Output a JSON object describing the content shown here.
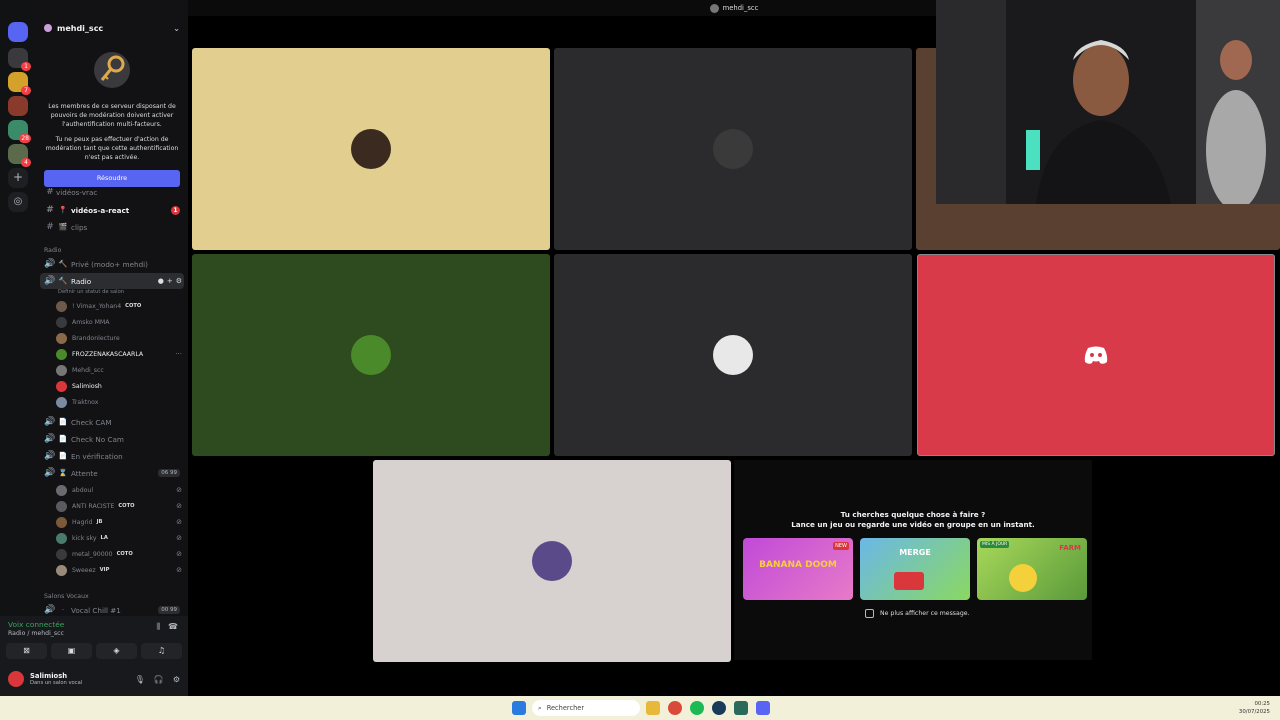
{
  "server": {
    "name": "mehdi_scc"
  },
  "mfa": {
    "text1": "Les membres de ce serveur disposant de pouvoirs de modération doivent activer l'authentification multi-facteurs.",
    "text2": "Tu ne peux pas effectuer d'action de modération tant que cette authentification n'est pas activée.",
    "resolve": "Résoudre"
  },
  "channels": {
    "partial": "vidéos-vrac",
    "videos": "vidéos-a-react",
    "videos_unread": "1",
    "clips": "clips",
    "cat_radio": "Radio",
    "prive": "Privé (modo+ mehdi)",
    "radio": "Radio",
    "radio_status": "Définir un statut de salon",
    "check_cam": "Check CAM",
    "check_nocam": "Check No Cam",
    "verification": "En vérification",
    "attente": "Attente",
    "attente_count": "06 99",
    "cat_vocaux": "Salons Vocaux",
    "chill": "Vocal Chill #1",
    "chill_count": "00 99"
  },
  "radio_users": [
    {
      "name": "! Vimax_Yohan4",
      "tag": "COTO"
    },
    {
      "name": "Amsko MMA",
      "tag": ""
    },
    {
      "name": "Brandonlecture",
      "tag": ""
    },
    {
      "name": "FROZZENAKASCAARLA",
      "tag": ""
    },
    {
      "name": "Mehdi_scc",
      "tag": ""
    },
    {
      "name": "Salimiosh",
      "tag": ""
    },
    {
      "name": "Traktnox",
      "tag": ""
    }
  ],
  "attente_users": [
    {
      "name": "abdoul",
      "tag": ""
    },
    {
      "name": "ANTI RACISTE",
      "tag": "COTO"
    },
    {
      "name": "Hagrid",
      "tag": "JB"
    },
    {
      "name": "kick sky",
      "tag": "LA"
    },
    {
      "name": "metal_90000",
      "tag": "COTO"
    },
    {
      "name": "Sweeez",
      "tag": "VIP"
    }
  ],
  "voice": {
    "status": "Voix connectée",
    "location": "Radio / mehdi_scc"
  },
  "user": {
    "name": "Salimiosh",
    "status": "Dans un salon vocal"
  },
  "stage": {
    "title": "mehdi_scc",
    "tile_colors": [
      "#e2cf90",
      "#2b2b2e",
      "#2e4a1f",
      "#2b2b2e",
      "#d83a4a",
      "#d7d1cf"
    ]
  },
  "activity": {
    "line1": "Tu cherches quelque chose à faire ?",
    "line2": "Lance un jeu ou regarde une vidéo en groupe en un instant.",
    "games": [
      {
        "name": "BANANA DOOM",
        "badge": "NEW"
      },
      {
        "name": "MERGE",
        "badge": ""
      },
      {
        "name": "FARM",
        "badge": "MIS À JOUR"
      }
    ],
    "checkbox": "Ne plus afficher ce message."
  },
  "taskbar": {
    "search": "Rechercher",
    "time": "00:25",
    "date": "30/07/2025"
  }
}
